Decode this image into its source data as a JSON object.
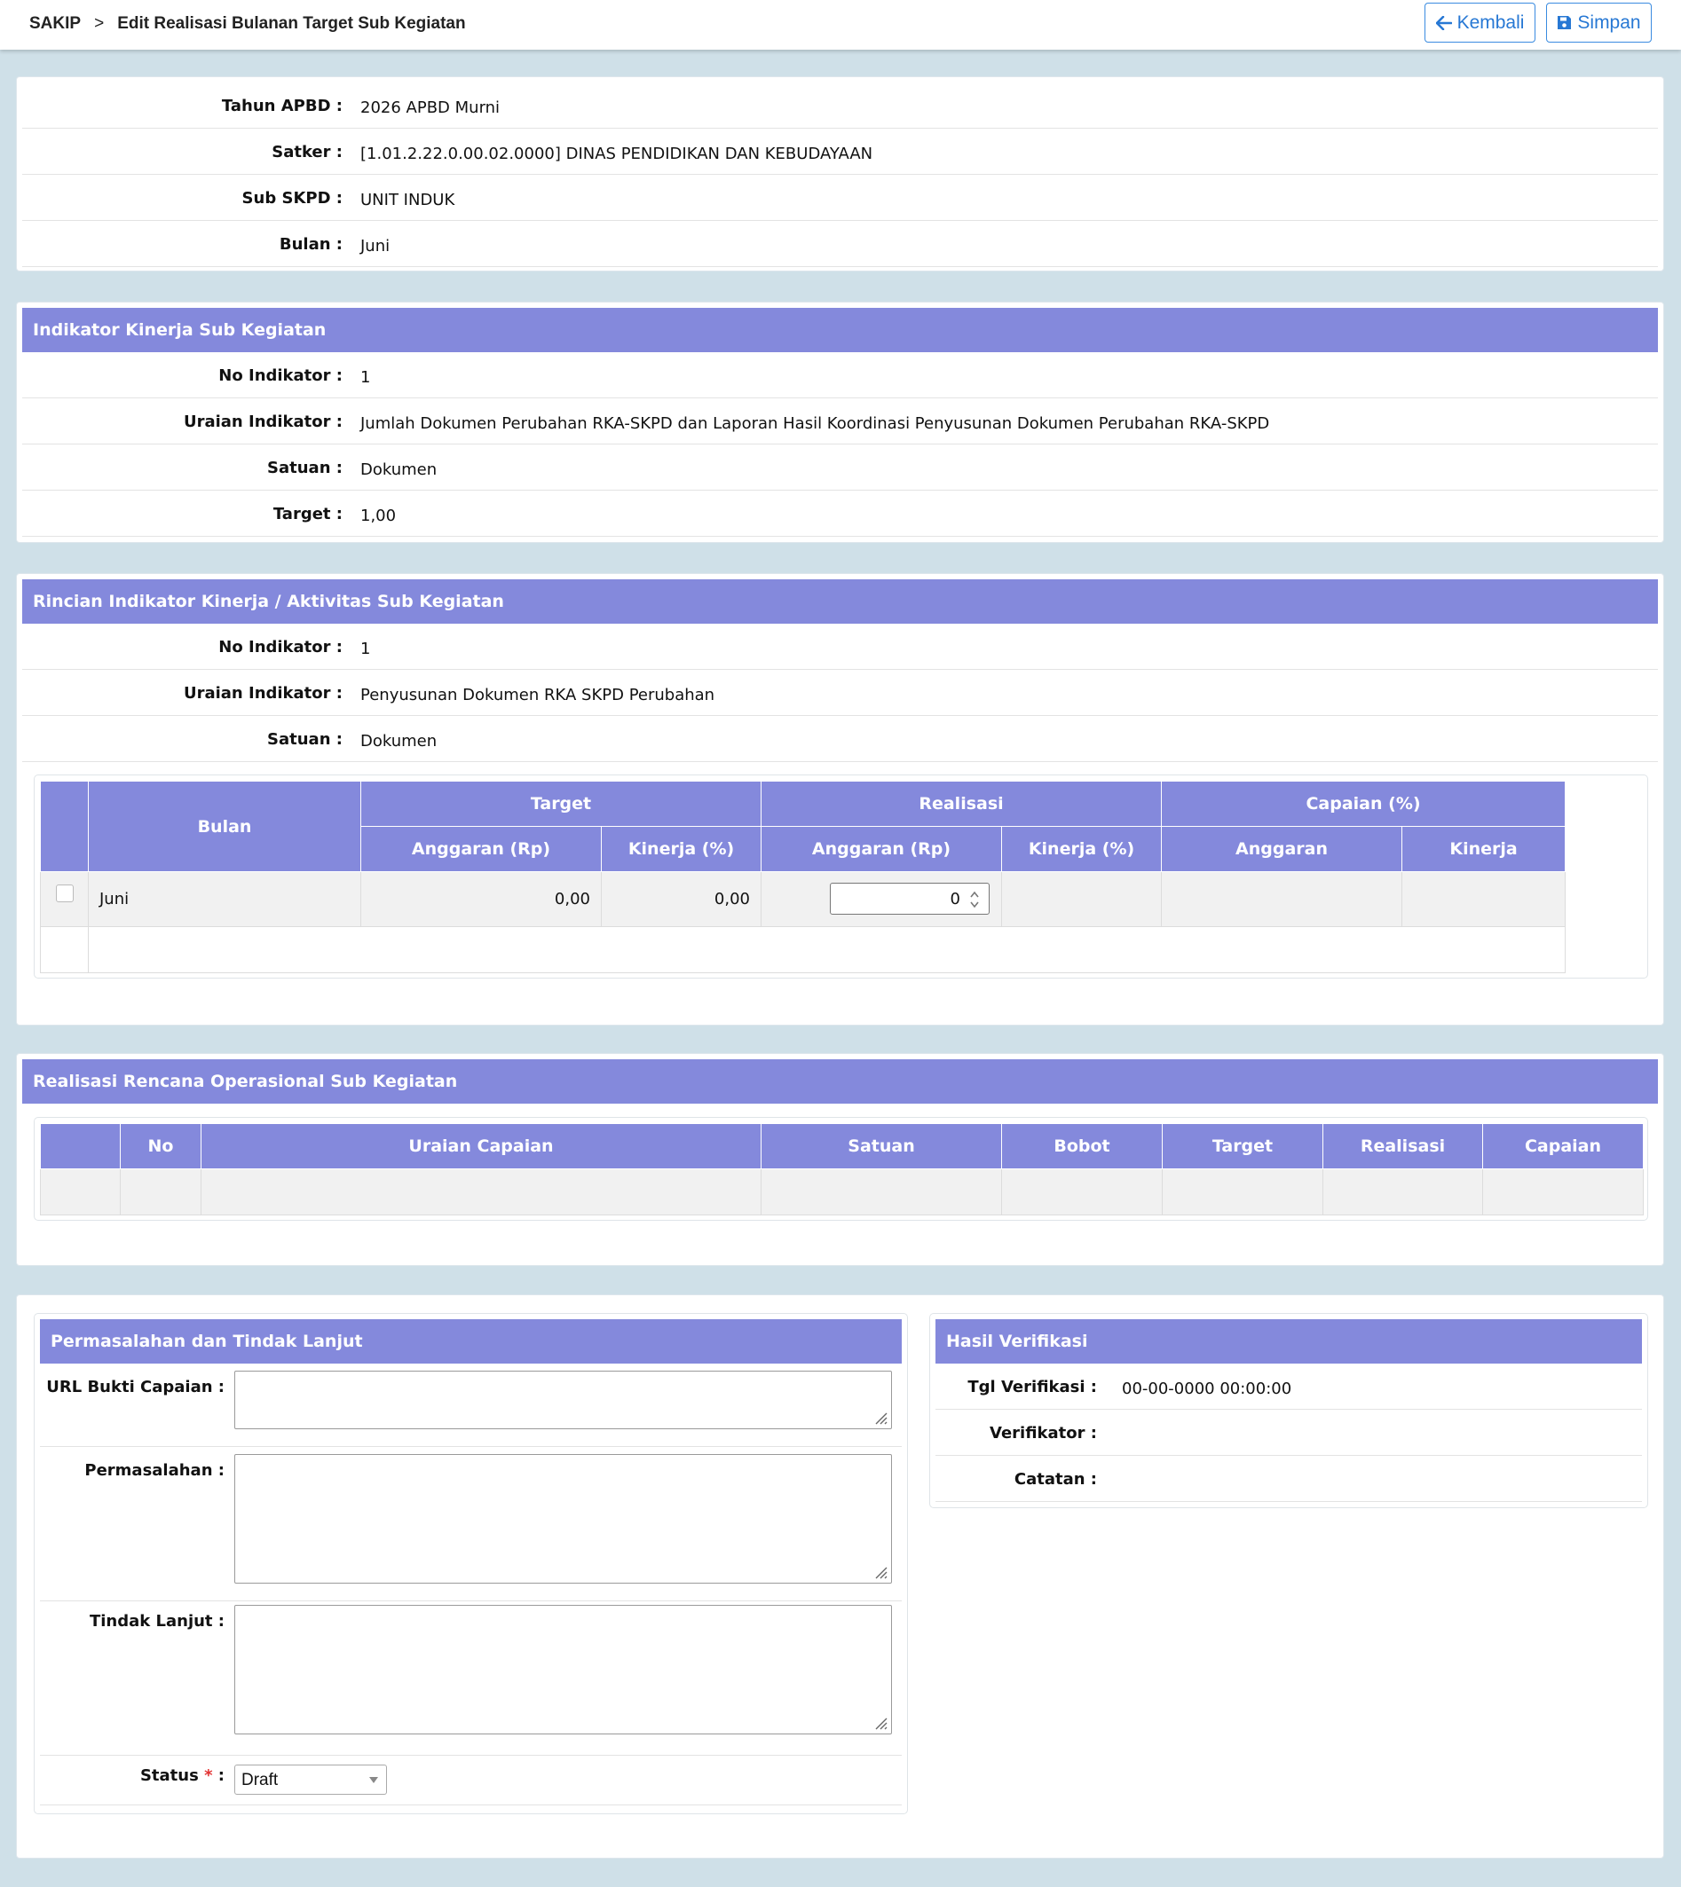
{
  "breadcrumb": {
    "root": "SAKIP",
    "separator": ">",
    "current": "Edit Realisasi Bulanan Target Sub Kegiatan"
  },
  "toolbar": {
    "back_label": "Kembali",
    "save_label": "Simpan"
  },
  "info": {
    "tahun_label": "Tahun APBD :",
    "tahun_value": "2026 APBD Murni",
    "satker_label": "Satker :",
    "satker_value": "[1.01.2.22.0.00.02.0000] DINAS PENDIDIKAN DAN KEBUDAYAAN",
    "subskpd_label": "Sub SKPD :",
    "subskpd_value": "UNIT INDUK",
    "bulan_label": "Bulan :",
    "bulan_value": "Juni"
  },
  "indikator": {
    "title": "Indikator Kinerja Sub Kegiatan",
    "no_label": "No Indikator :",
    "no_value": "1",
    "uraian_label": "Uraian Indikator :",
    "uraian_value": "Jumlah Dokumen Perubahan RKA-SKPD dan Laporan Hasil Koordinasi Penyusunan Dokumen Perubahan RKA-SKPD",
    "satuan_label": "Satuan :",
    "satuan_value": "Dokumen",
    "target_label": "Target :",
    "target_value": "1,00"
  },
  "rincian": {
    "title": "Rincian Indikator Kinerja / Aktivitas Sub Kegiatan",
    "no_label": "No Indikator :",
    "no_value": "1",
    "uraian_label": "Uraian Indikator :",
    "uraian_value": "Penyusunan Dokumen RKA SKPD Perubahan",
    "satuan_label": "Satuan :",
    "satuan_value": "Dokumen",
    "table": {
      "col_bulan": "Bulan",
      "grp_target": "Target",
      "grp_realisasi": "Realisasi",
      "grp_capaian": "Capaian (%)",
      "sub_anggaran_rp": "Anggaran (Rp)",
      "sub_kinerja_pct": "Kinerja (%)",
      "sub_anggaran": "Anggaran",
      "sub_kinerja": "Kinerja",
      "row": {
        "bulan": "Juni",
        "target_anggaran": "0,00",
        "target_kinerja": "0,00",
        "realisasi_anggaran_input": "0"
      }
    }
  },
  "rencana": {
    "title": "Realisasi Rencana Operasional Sub Kegiatan",
    "cols": {
      "no": "No",
      "uraian": "Uraian Capaian",
      "satuan": "Satuan",
      "bobot": "Bobot",
      "target": "Target",
      "realisasi": "Realisasi",
      "capaian": "Capaian"
    }
  },
  "permasalahan": {
    "title": "Permasalahan dan Tindak Lanjut",
    "url_label": "URL Bukti Capaian :",
    "url_value": "",
    "masalah_label": "Permasalahan :",
    "masalah_value": "",
    "tindak_label": "Tindak Lanjut :",
    "tindak_value": "",
    "status_label": "Status",
    "status_req": "*",
    "status_colon": ":",
    "status_value": "Draft"
  },
  "verifikasi": {
    "title": "Hasil Verifikasi",
    "tgl_label": "Tgl Verifikasi :",
    "tgl_value": "00-00-0000 00:00:00",
    "verifikator_label": "Verifikator :",
    "verifikator_value": "",
    "catatan_label": "Catatan :",
    "catatan_value": ""
  },
  "colors": {
    "header": "#8489dc",
    "accent": "#2778d4",
    "required": "#e23232",
    "background": "#cfe0e8"
  }
}
